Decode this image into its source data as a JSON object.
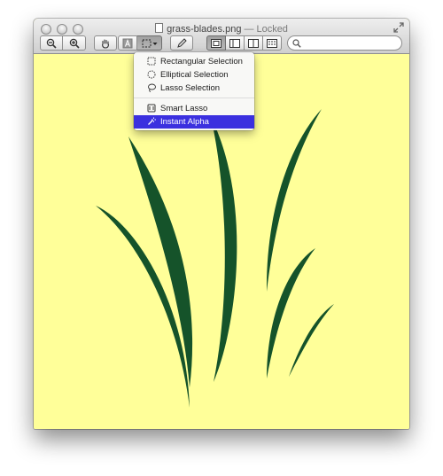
{
  "window": {
    "filename": "grass-blades.png",
    "separator": "—",
    "status": "Locked"
  },
  "toolbar": {
    "buttons": [
      {
        "name": "zoom-out-icon"
      },
      {
        "name": "zoom-in-icon"
      },
      {
        "name": "hand-icon"
      },
      {
        "name": "text-select-icon"
      },
      {
        "name": "selection-tool-icon"
      },
      {
        "name": "annotate-pen-icon"
      },
      {
        "name": "view-single-icon"
      },
      {
        "name": "view-sidebar-icon"
      },
      {
        "name": "view-sidebar-right-icon"
      },
      {
        "name": "view-thumbnails-icon"
      }
    ],
    "search_placeholder": ""
  },
  "selection_menu": {
    "items": [
      {
        "label": "Rectangular Selection",
        "icon": "rectangular-selection-icon"
      },
      {
        "label": "Elliptical Selection",
        "icon": "elliptical-selection-icon"
      },
      {
        "label": "Lasso Selection",
        "icon": "lasso-icon"
      },
      {
        "label": "Smart Lasso",
        "icon": "smart-lasso-icon"
      },
      {
        "label": "Instant Alpha",
        "icon": "magic-wand-icon",
        "selected": true
      }
    ]
  },
  "colors": {
    "canvas_background": "#ffff99",
    "grass": "#15532a",
    "menu_highlight": "#3b30df"
  }
}
